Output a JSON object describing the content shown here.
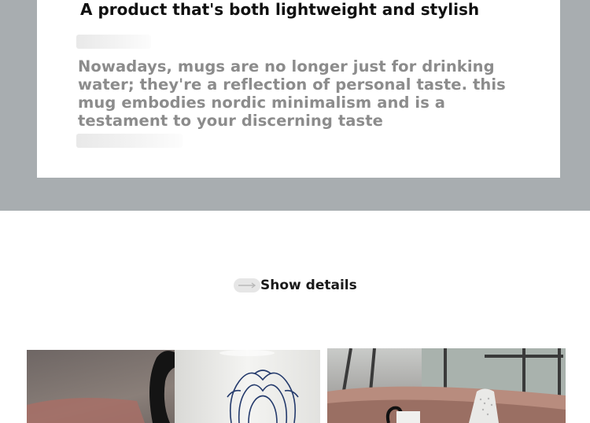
{
  "feature_card": {
    "title": "A product that's both lightweight and stylish",
    "description": "Nowadays, mugs are no longer just for drinking water; they're a reflection of personal taste. this mug embodies nordic minimalism and is a testament to your discerning taste"
  },
  "details": {
    "label": "Show details",
    "arrow_icon": "arrow-right-icon"
  },
  "gallery": {
    "left_photo": "mug-photo-floral",
    "right_photo": "mug-photo-window"
  },
  "colors": {
    "band": "#a8adb0",
    "title": "#111111",
    "description": "#8c8c8c"
  }
}
